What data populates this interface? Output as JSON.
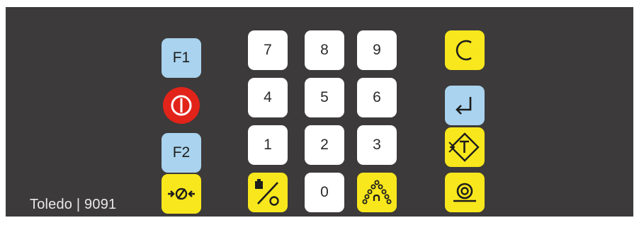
{
  "keypad": {
    "brand_label": "Toledo | 9091",
    "keys": {
      "f1": "F1",
      "f2": "F2",
      "k7": "7",
      "k8": "8",
      "k9": "9",
      "k4": "4",
      "k5": "5",
      "k6": "6",
      "k1": "1",
      "k2": "2",
      "k3": "3",
      "k0": "0"
    },
    "icons": {
      "power": "power-icon",
      "clear": "clear-c-icon",
      "enter": "enter-return-icon",
      "tare": "tare-icon",
      "zero": "zero-icon",
      "unit_weight": "unit-weight-icon",
      "count": "piece-count-icon",
      "print": "print-roll-icon"
    }
  },
  "colors": {
    "panel": "#3c3a3a",
    "white_key": "#ffffff",
    "blue_key": "#a9d3ee",
    "yellow_key": "#f8e71c",
    "power_red": "#e2231a"
  }
}
